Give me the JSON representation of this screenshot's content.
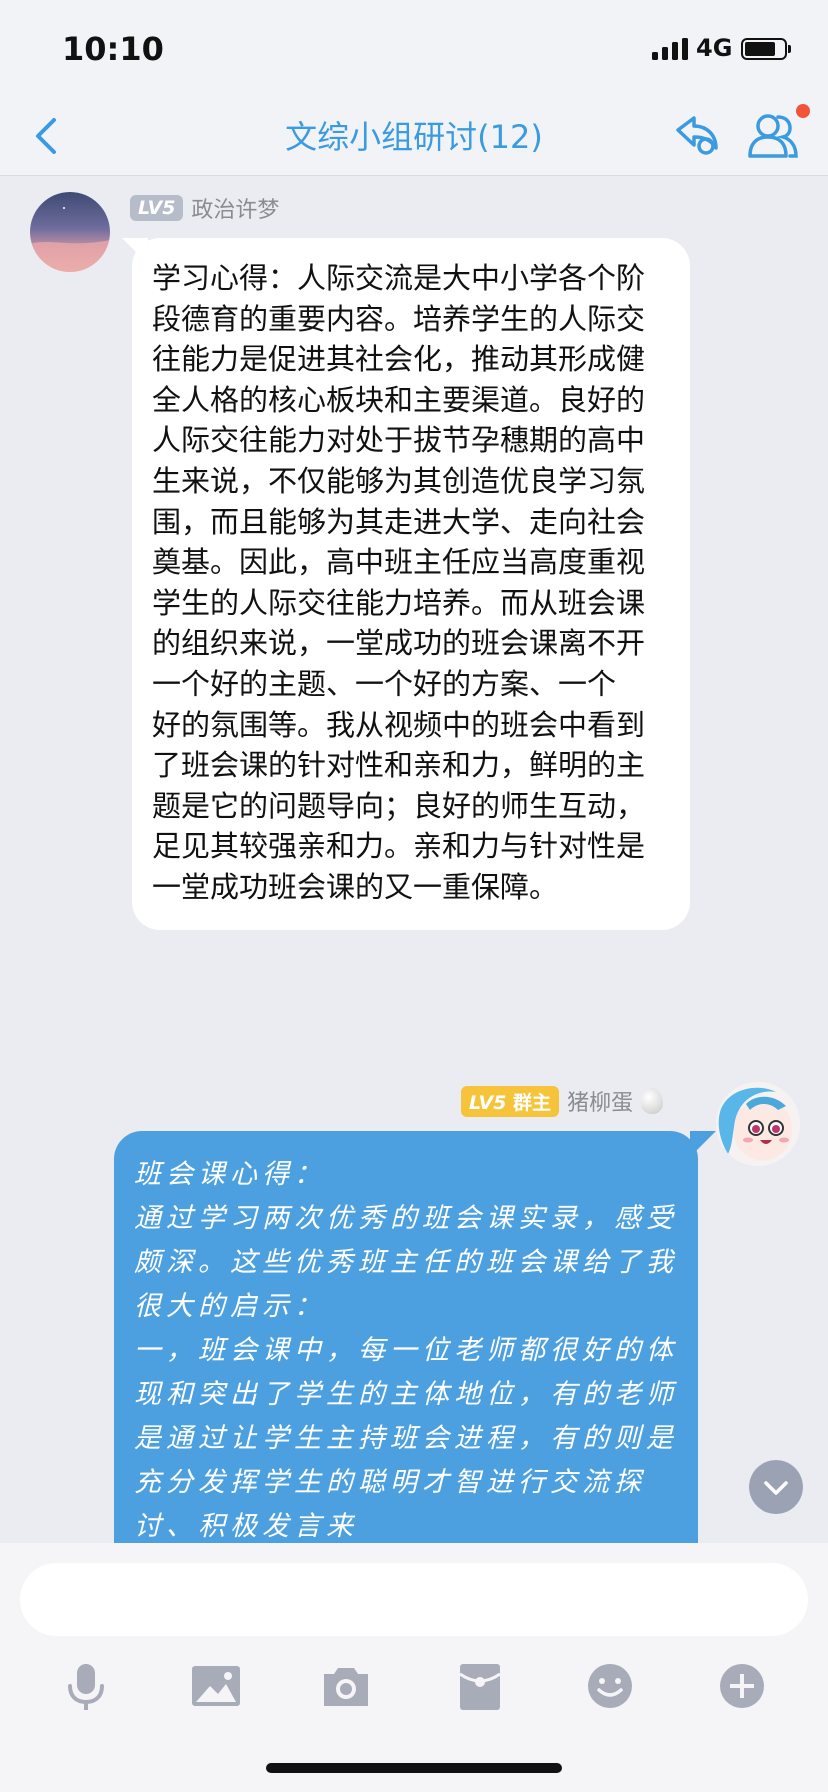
{
  "status_bar": {
    "time": "10:10",
    "network": "4G",
    "battery_level": 0.8
  },
  "header": {
    "back_icon": "chevron-left-icon",
    "title": "文综小组研讨(12)",
    "action_icon": "group-settings-icon",
    "members_icon": "group-members-icon",
    "accent_color": "#3a9be0",
    "notification_color": "#f2533b"
  },
  "messages": [
    {
      "side": "left",
      "level": "LV5",
      "sender": "政治许梦",
      "text": "学习心得：人际交流是大中小学各个阶段德育的重要内容。培养学生的人际交往能力是促进其社会化，推动其形成健全人格的核心板块和主要渠道。良好的人际交往能力对处于拔节孕穗期的高中生来说，不仅能够为其创造优良学习氛围，而且能够为其走进大学、走向社会奠基。因此，高中班主任应当高度重视学生的人际交往能力培养。而从班会课的组织来说，一堂成功的班会课离不开一个好的主题、一个好的方案、一个\n好的氛围等。我从视频中的班会中看到了班会课的针对性和亲和力，鲜明的主题是它的问题导向；良好的师生互动，足见其较强亲和力。亲和力与针对性是一堂成功班会课的又一重保障。"
    },
    {
      "side": "right",
      "level": "LV5",
      "role": "群主",
      "sender": "猪柳蛋",
      "text": "班会课心得：\n通过学习两次优秀的班会课实录，感受颇深。这些优秀班主任的班会课给了我很大的启示：\n一，班会课中，每一位老师都很好的体现和突出了学生的主体地位，有的老师是通过让学生主持班会进程，有的则是充分发挥学生的聪明才智进行交流探讨、积极发言来",
      "bubble_color": "#4da0e0"
    }
  ],
  "scroll_button": {
    "icon": "chevron-down-icon"
  },
  "input": {
    "value": "",
    "placeholder": ""
  },
  "toolbar": [
    "microphone-icon",
    "image-icon",
    "camera-icon",
    "red-packet-icon",
    "emoji-icon",
    "plus-icon"
  ]
}
